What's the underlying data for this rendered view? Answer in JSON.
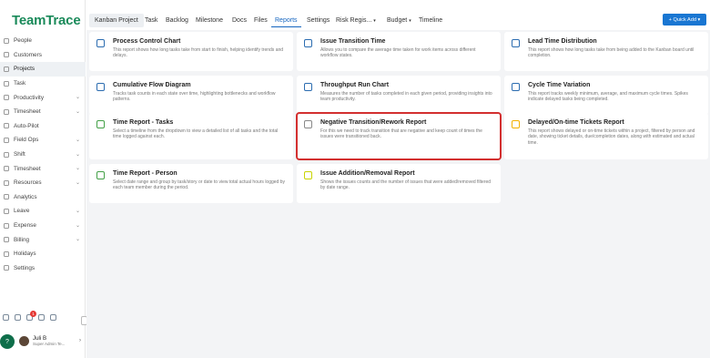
{
  "app": {
    "logo": "TeamTrace"
  },
  "sidebar": {
    "items": [
      {
        "label": "People",
        "icon": "people-icon",
        "chevron": false
      },
      {
        "label": "Customers",
        "icon": "customers-icon",
        "chevron": false
      },
      {
        "label": "Projects",
        "icon": "projects-icon",
        "chevron": false,
        "active": true
      },
      {
        "label": "Task",
        "icon": "task-icon",
        "chevron": false
      },
      {
        "label": "Productivity",
        "icon": "productivity-icon",
        "chevron": true
      },
      {
        "label": "Timesheet",
        "icon": "timesheet-icon",
        "chevron": true
      },
      {
        "label": "Auto-Pilot",
        "icon": "auto-pilot-icon",
        "chevron": false
      },
      {
        "label": "Field Ops",
        "icon": "field-ops-icon",
        "chevron": true
      },
      {
        "label": "Shift",
        "icon": "shift-icon",
        "chevron": true
      },
      {
        "label": "Timesheet",
        "icon": "timesheet-icon",
        "chevron": true
      },
      {
        "label": "Resources",
        "icon": "resources-icon",
        "chevron": true
      },
      {
        "label": "Analytics",
        "icon": "analytics-icon",
        "chevron": false
      },
      {
        "label": "Leave",
        "icon": "leave-icon",
        "chevron": true
      },
      {
        "label": "Expense",
        "icon": "expense-icon",
        "chevron": true
      },
      {
        "label": "Billing",
        "icon": "billing-icon",
        "chevron": true
      },
      {
        "label": "Holidays",
        "icon": "holidays-icon",
        "chevron": false
      },
      {
        "label": "Settings",
        "icon": "settings-icon",
        "chevron": false
      }
    ],
    "notification_count": "1",
    "user": {
      "name": "Juli B",
      "role": "Super Admin Te..."
    }
  },
  "tabs": [
    {
      "label": "Kanban Project",
      "dropdown": false
    },
    {
      "label": "Task",
      "dropdown": false
    },
    {
      "label": "Backlog",
      "dropdown": false
    },
    {
      "label": "Milestone",
      "dropdown": false
    },
    {
      "label": "Docs",
      "dropdown": false
    },
    {
      "label": "Files",
      "dropdown": false
    },
    {
      "label": "Reports",
      "dropdown": false,
      "active": true
    },
    {
      "label": "Settings",
      "dropdown": false
    },
    {
      "label": "Risk Regis...",
      "dropdown": true
    },
    {
      "label": "Budget",
      "dropdown": true
    },
    {
      "label": "Timeline",
      "dropdown": false
    }
  ],
  "quick_add": {
    "label": "+ Quick Add ▾"
  },
  "reports": [
    {
      "title": "Process Control Chart",
      "desc": "This report shows how long tasks take from start to finish, helping identify trends and delays.",
      "icon": "process-control-chart-icon",
      "color": "#2b6cb0"
    },
    {
      "title": "Issue Transition Time",
      "desc": "Allows you to compare the average time taken for work items across different workflow states.",
      "icon": "issue-transition-icon",
      "color": "#2b6cb0"
    },
    {
      "title": "Lead Time Distribution",
      "desc": "This report shows how long tasks take from being added to the Kanban board until completion.",
      "icon": "lead-time-icon",
      "color": "#2b6cb0"
    },
    {
      "title": "Cumulative Flow Diagram",
      "desc": "Tracks task counts in each state over time, highlighting bottlenecks and workflow patterns.",
      "icon": "cumulative-flow-icon",
      "color": "#2b6cb0"
    },
    {
      "title": "Throughput Run Chart",
      "desc": "Measures the number of tasks completed in each given period, providing insights into team productivity.",
      "icon": "throughput-icon",
      "color": "#2b6cb0"
    },
    {
      "title": "Cycle Time Variation",
      "desc": "This report tracks weekly minimum, average, and maximum cycle times. Spikes indicate delayed tasks being completed.",
      "icon": "cycle-time-icon",
      "color": "#2b6cb0"
    },
    {
      "title": "Time Report - Tasks",
      "desc": "Select a timeline from the dropdown to view a detailed list of all tasks and the total time logged against each.",
      "icon": "time-report-tasks-icon",
      "color": "#43a047"
    },
    {
      "title": "Negative Transition/Rework Report",
      "desc": "For this we need to track transition that are negative and keep count of times the issues were transitioned back.",
      "icon": "negative-transition-icon",
      "color": "#888888",
      "highlight": true
    },
    {
      "title": "Delayed/On-time Tickets Report",
      "desc": "This report shows delayed or on-time tickets within a project, filtered by person and date, showing ticket details, due/completion dates, along with estimated and actual time.",
      "icon": "delayed-tickets-icon",
      "color": "#f2b100"
    },
    {
      "title": "Time Report - Person",
      "desc": "Select date range and group by task/story or date to view total actual hours logged by each team member during the period.",
      "icon": "time-report-person-icon",
      "color": "#43a047"
    },
    {
      "title": "Issue Addition/Removal Report",
      "desc": "Shows the issues counts and the number of issues that were added/removed filtered by date range.",
      "icon": "issue-addition-icon",
      "color": "#c8d400"
    }
  ]
}
